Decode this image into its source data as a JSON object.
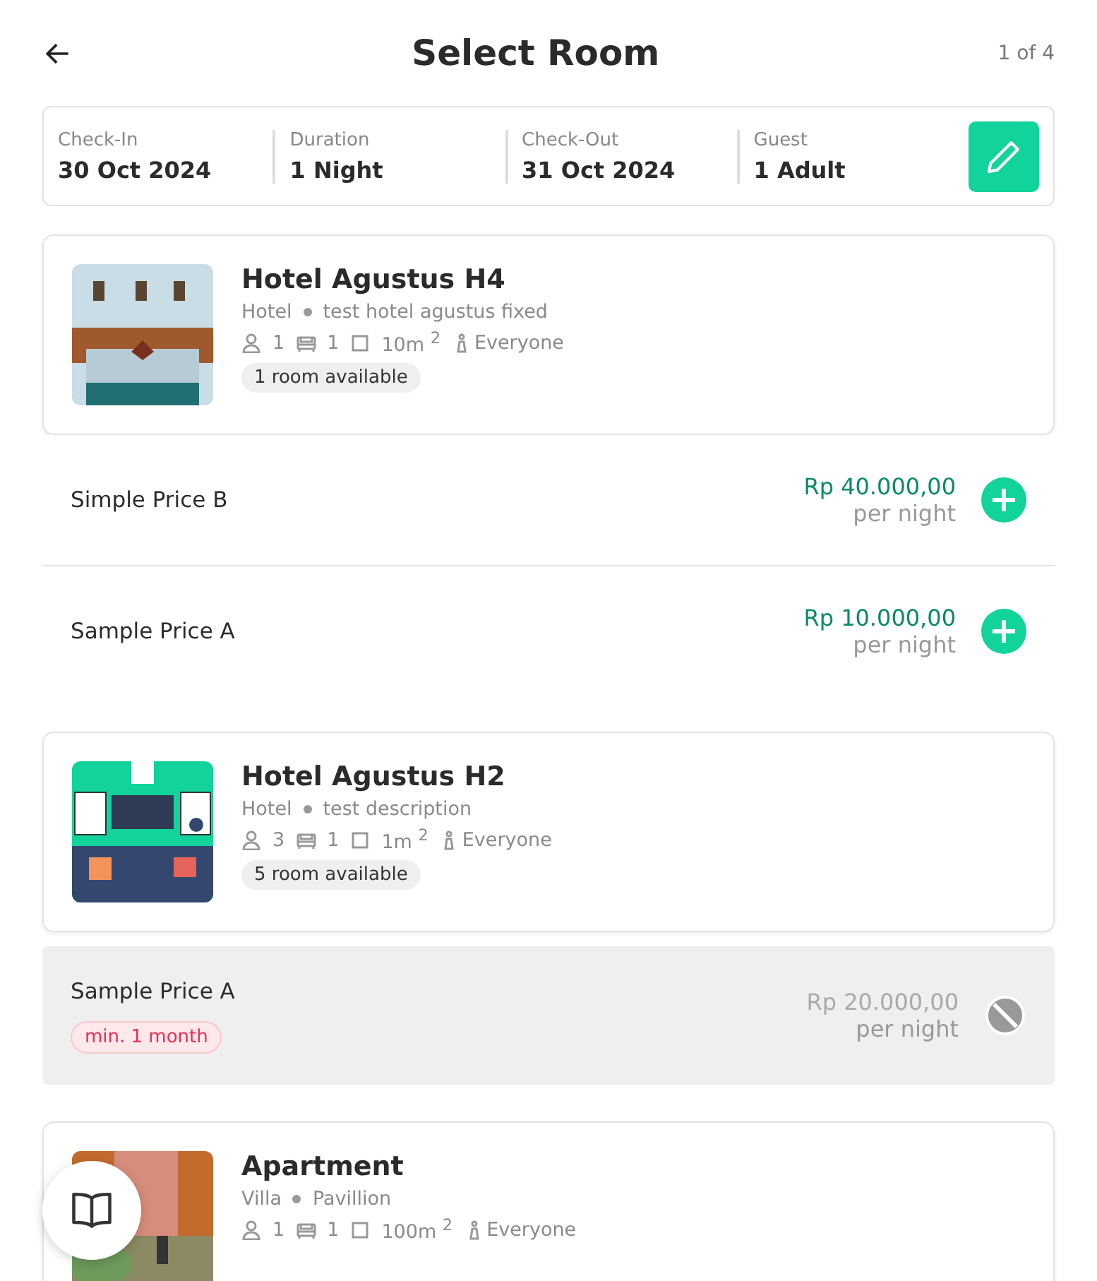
{
  "header": {
    "title": "Select Room",
    "step": "1 of 4"
  },
  "summary": [
    {
      "label": "Check-In",
      "value": "30 Oct 2024"
    },
    {
      "label": "Duration",
      "value": "1 Night"
    },
    {
      "label": "Check-Out",
      "value": "31 Oct 2024"
    },
    {
      "label": "Guest",
      "value": "1 Adult"
    }
  ],
  "rooms": [
    {
      "name": "Hotel Agustus H4",
      "type": "Hotel",
      "description": "test hotel agustus fixed",
      "guests": "1",
      "beds": "1",
      "size": "10m $^{2}$",
      "gender": "Everyone",
      "availability": "1 room available",
      "picture": {
        "kind": "picture"
      },
      "prices": [
        {
          "name": "Simple Price B",
          "amount": "Rp 40.000,00",
          "unit": "per night",
          "disabled": false
        },
        {
          "name": "Sample Price A",
          "amount": "Rp 10.000,00",
          "unit": "per night",
          "disabled": false
        }
      ]
    },
    {
      "name": "Hotel Agustus H2",
      "type": "Hotel",
      "description": "test description",
      "guests": "3",
      "beds": "1",
      "size": "1m $^{2}$",
      "gender": "Everyone",
      "availability": "5 room available",
      "picture": {
        "kind": "picture"
      },
      "prices": [
        {
          "name": "Sample Price A",
          "amount": "Rp 20.000,00",
          "unit": "per night",
          "disabled": true,
          "badge": "min. 1 month"
        }
      ]
    },
    {
      "name": "Apartment",
      "type": "Villa",
      "description": "Pavillion",
      "guests": "1",
      "beds": "1",
      "size": "100m $^{2}$",
      "gender": "Everyone",
      "picture": {
        "kind": "picture"
      }
    }
  ]
}
